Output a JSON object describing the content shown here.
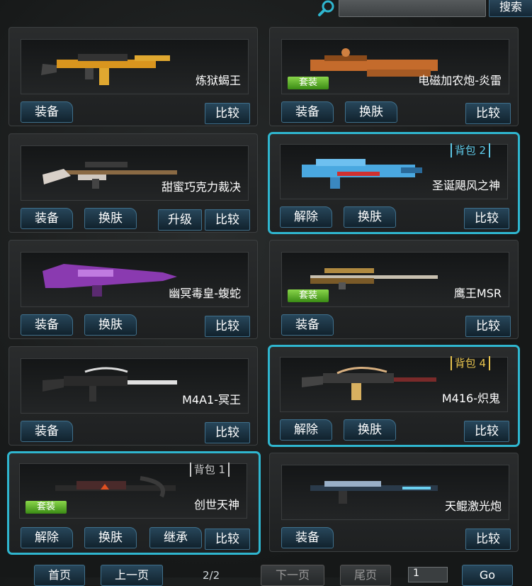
{
  "search": {
    "button_label": "搜索",
    "value": ""
  },
  "buttons": {
    "equip": "装备",
    "unequip": "解除",
    "skin": "换肤",
    "upgrade": "升级",
    "compare": "比较",
    "inherit": "继承"
  },
  "tags": {
    "suit": "套装"
  },
  "cards": [
    {
      "name": "炼狱蝎王"
    },
    {
      "name": "电磁加农炮-炎雷",
      "suit": "套装"
    },
    {
      "name": "甜蜜巧克力裁决"
    },
    {
      "name": "圣诞飓风之神",
      "pack": "背包 2"
    },
    {
      "name": "幽冥毒皇-蝮蛇"
    },
    {
      "name": "鹰王MSR",
      "suit": "套装"
    },
    {
      "name": "M4A1-冥王"
    },
    {
      "name": "M416-炽鬼",
      "pack": "背包 4"
    },
    {
      "name": "创世天神",
      "pack": "背包 1",
      "suit": "套装"
    },
    {
      "name": "天鲲激光炮"
    }
  ],
  "pager": {
    "first": "首页",
    "prev": "上一页",
    "page": "2/2",
    "next": "下一页",
    "last": "尾页",
    "input_value": "1",
    "go": "Go"
  }
}
